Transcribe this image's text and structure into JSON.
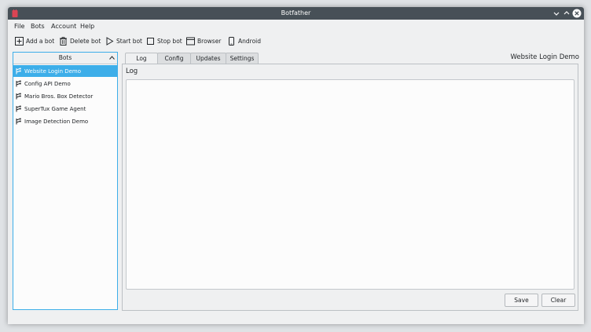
{
  "window": {
    "title": "Botfather"
  },
  "menubar": {
    "items": [
      "File",
      "Bots",
      "Account",
      "Help"
    ]
  },
  "toolbar": {
    "add_bot": "Add a bot",
    "delete_bot": "Delete bot",
    "start_bot": "Start bot",
    "stop_bot": "Stop bot",
    "browser": "Browser",
    "android": "Android"
  },
  "bots_panel": {
    "header": "Bots",
    "items": [
      "Website Login Demo",
      "Config API Demo",
      "Mario Bros. Box Detector",
      "SuperTux Game Agent",
      "Image Detection Demo"
    ],
    "selected_index": 0
  },
  "tabs": [
    "Log",
    "Config",
    "Updates",
    "Settings"
  ],
  "active_tab": "Log",
  "bot_title": "Website Login Demo",
  "log": {
    "label": "Log",
    "content": ""
  },
  "buttons": {
    "save": "Save",
    "clear": "Clear"
  },
  "colors": {
    "accent": "#3daee9",
    "titlebar": "#475057",
    "window_bg": "#eff0f1"
  }
}
